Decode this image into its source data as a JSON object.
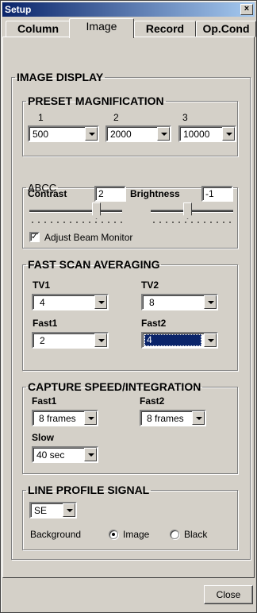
{
  "window": {
    "title": "Setup",
    "close_glyph": "×"
  },
  "tabs": [
    {
      "label": "Column"
    },
    {
      "label": "Image"
    },
    {
      "label": "Record"
    },
    {
      "label": "Op.Cond"
    }
  ],
  "image_display": {
    "title": "IMAGE DISPLAY",
    "preset": {
      "title": "PRESET MAGNIFICATION",
      "headers": [
        "1",
        "2",
        "3"
      ],
      "values": [
        "500",
        "2000",
        "10000"
      ]
    },
    "abcc": {
      "title": "ABCC",
      "contrast_label": "Contrast",
      "contrast_value": "2",
      "brightness_label": "Brightness",
      "brightness_value": "-1",
      "adjust_beam_label": "Adjust Beam Monitor",
      "adjust_beam_checked": true,
      "checkmark": "✓"
    },
    "fast_scan": {
      "title": "FAST SCAN AVERAGING",
      "tv1_label": "TV1",
      "tv1_value": "4",
      "tv2_label": "TV2",
      "tv2_value": "8",
      "fast1_label": "Fast1",
      "fast1_value": "2",
      "fast2_label": "Fast2",
      "fast2_value": "4"
    },
    "capture": {
      "title": "CAPTURE SPEED/INTEGRATION",
      "fast1_label": "Fast1",
      "fast1_value": "8 frames",
      "fast2_label": "Fast2",
      "fast2_value": "8 frames",
      "slow_label": "Slow",
      "slow_value": "40 sec"
    },
    "line_profile": {
      "title": "LINE PROFILE SIGNAL",
      "signal_value": "SE",
      "background_label": "Background",
      "options": [
        "Image",
        "Black"
      ],
      "selected": "Image"
    }
  },
  "footer": {
    "close_label": "Close"
  },
  "colors": {
    "face": "#d4d0c8",
    "title_start": "#0a246a",
    "title_end": "#a6caf0",
    "selection": "#0a246a"
  }
}
